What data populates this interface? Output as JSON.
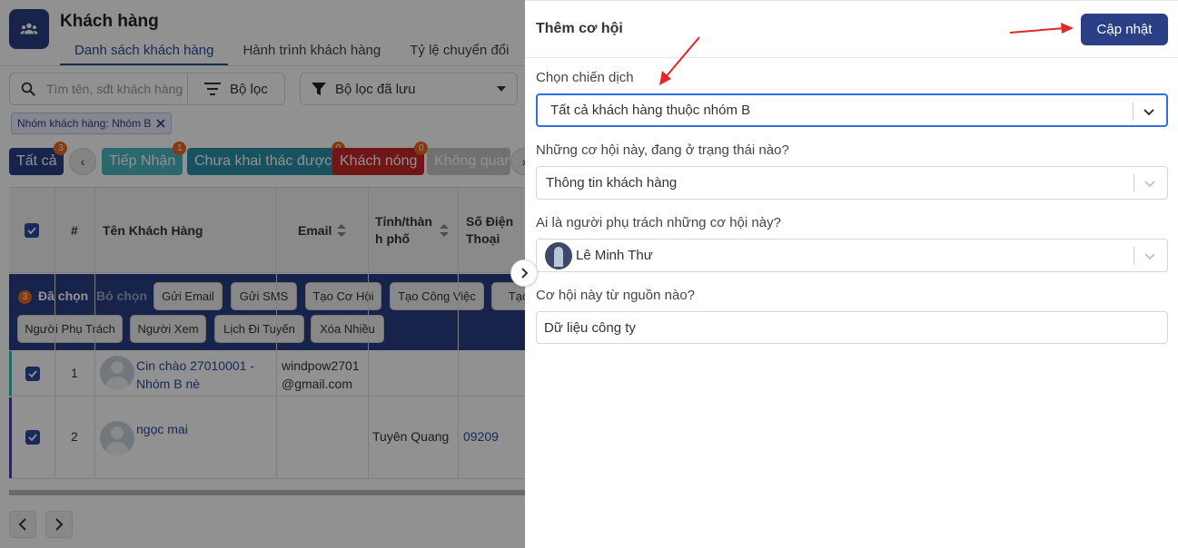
{
  "page": {
    "title": "Khách hàng",
    "tabs": [
      "Danh sách khách hàng",
      "Hành trình khách hàng",
      "Tỷ lệ chuyển đổi"
    ],
    "search_placeholder": "Tìm tên, sđt khách hàng",
    "filter_label": "Bộ lọc",
    "saved_filter_label": "Bộ lọc đã lưu",
    "active_chip": "Nhóm khách hàng: Nhóm B",
    "statuses": [
      {
        "label": "Tất cả",
        "count": "3",
        "color": "#2b3f86"
      },
      {
        "label": "Tiếp Nhận",
        "count": "1",
        "color": "#4cb7c2"
      },
      {
        "label": "Chưa khai thác được",
        "count": "",
        "color": "#2b8fa8"
      },
      {
        "label": "Khách nóng",
        "count": "0",
        "color": "#c62828"
      },
      {
        "label": "Không quan",
        "count": "",
        "color": "#c7c7c7"
      }
    ],
    "extra_badge": "0"
  },
  "table": {
    "headers": {
      "num": "#",
      "name": "Tên Khách Hàng",
      "email": "Email",
      "province": "Tỉnh/thàn h phố",
      "phone": "Số Điện Thoại"
    },
    "selection": {
      "count": "3",
      "selected_label": "Đã chọn",
      "clear_label": "Bỏ chọn",
      "actions": [
        "Gửi Email",
        "Gửi SMS",
        "Tạo Cơ Hội",
        "Tạo Công Việc",
        "Tạo",
        "Người Phụ Trách",
        "Người Xem",
        "Lịch Đi Tuyến",
        "Xóa Nhiều"
      ]
    },
    "rows": [
      {
        "index": "1",
        "name": "Cin chào 27010001 - Nhóm B nè",
        "email": "windpow2701 @gmail.com",
        "province": "",
        "phone": "",
        "bar_color": "#36b3b8"
      },
      {
        "index": "2",
        "name": "ngọc mai",
        "email": "",
        "province": "Tuyên Quang",
        "phone": "09209",
        "bar_color": "#4b3fa0"
      }
    ]
  },
  "drawer": {
    "title": "Thêm cơ hội",
    "update_button": "Cập nhật",
    "fields": [
      {
        "label": "Chọn chiến dịch",
        "value": "Tất cả khách hàng thuộc nhóm B"
      },
      {
        "label": "Những cơ hội này, đang ở trạng thái nào?",
        "value": "Thông tin khách hàng"
      },
      {
        "label": "Ai là người phụ trách những cơ hội này?",
        "value": "Lê Minh Thư"
      },
      {
        "label": "Cơ hội này từ nguồn nào?",
        "value": "Dữ liệu công ty"
      }
    ]
  },
  "colors": {
    "primary": "#2b3f86",
    "focus": "#2f6fe0",
    "badge": "#e8681a",
    "annotation": "#e3262b"
  }
}
